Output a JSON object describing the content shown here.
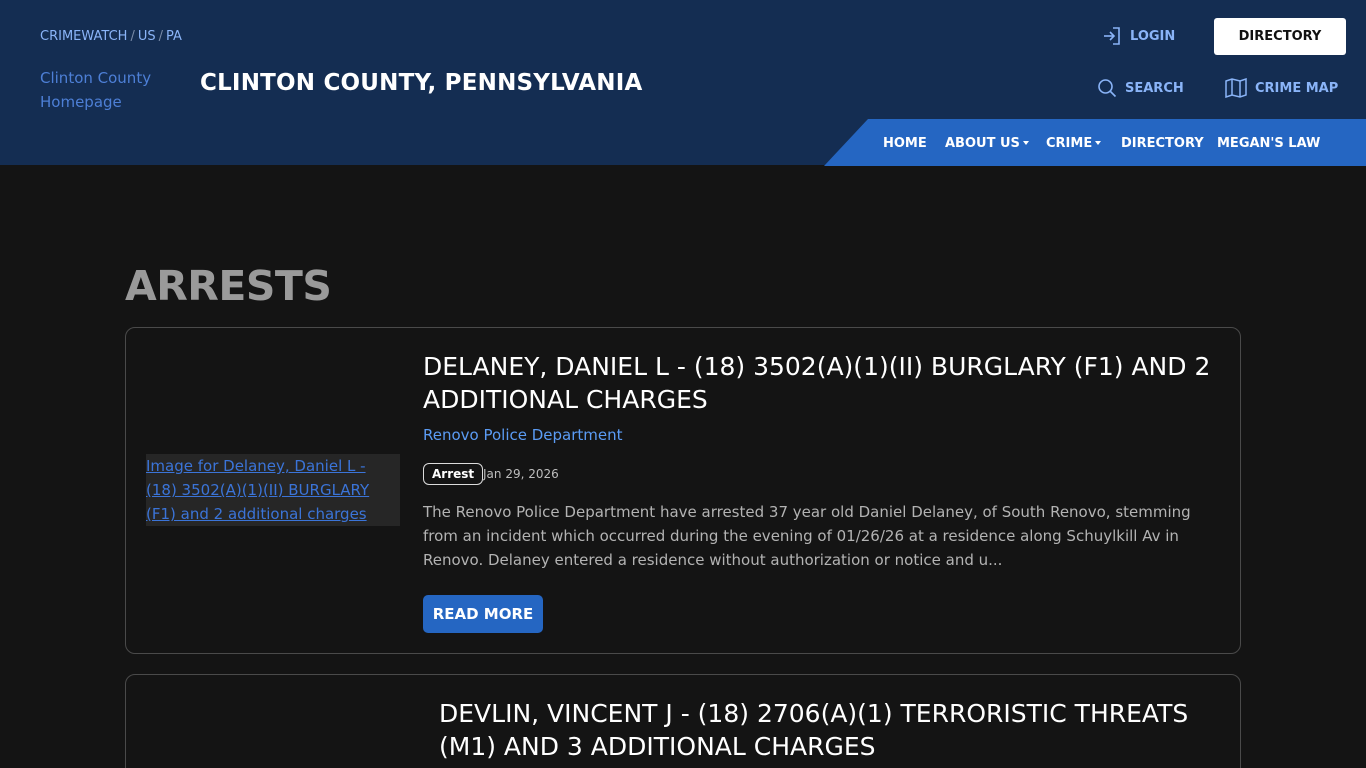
{
  "breadcrumb": {
    "items": [
      "CRIMEWATCH",
      "US",
      "PA"
    ],
    "separator": "/"
  },
  "logo_alt": "Clinton County Homepage",
  "site_title": "CLINTON COUNTY, PENNSYLVANIA",
  "header_links": {
    "login": "LOGIN",
    "directory_button": "DIRECTORY",
    "search": "SEARCH",
    "crime_map": "CRIME MAP"
  },
  "icons": {
    "login": "login-arrow-icon",
    "search": "search-icon",
    "crime_map": "map-icon",
    "dropdown": "chevron-down-icon"
  },
  "nav": {
    "home": "HOME",
    "about": "ABOUT US",
    "crime": "CRIME",
    "directory": "DIRECTORY",
    "megans_law": "MEGAN'S LAW"
  },
  "page_heading": "ARRESTS",
  "arrests": [
    {
      "image_alt": "Image for Delaney, Daniel L - (18) 3502(A)(1)(II) BURGLARY (F1) and 2 additional charges",
      "title": "DELANEY, DANIEL L - (18) 3502(A)(1)(II) BURGLARY (F1) AND 2 ADDITIONAL CHARGES",
      "agency": "Renovo Police Department",
      "badge": "Arrest",
      "date": "Jan 29, 2026",
      "excerpt": "The Renovo Police Department have arrested 37 year old Daniel Delaney, of South Renovo, stemming from an incident which occurred during the evening of 01/26/26 at a residence along Schuylkill Av in Renovo.  Delaney entered a residence without authorization or notice and u...",
      "read_more": "READ MORE"
    },
    {
      "title": "DEVLIN, VINCENT J - (18) 2706(A)(1) TERRORISTIC THREATS (M1) AND 3 ADDITIONAL CHARGES"
    }
  ],
  "colors": {
    "header_bg": "#142d52",
    "nav_bg": "#2566c2",
    "page_bg": "#141414",
    "link": "#8ab4f8",
    "accent": "#2566c2"
  }
}
